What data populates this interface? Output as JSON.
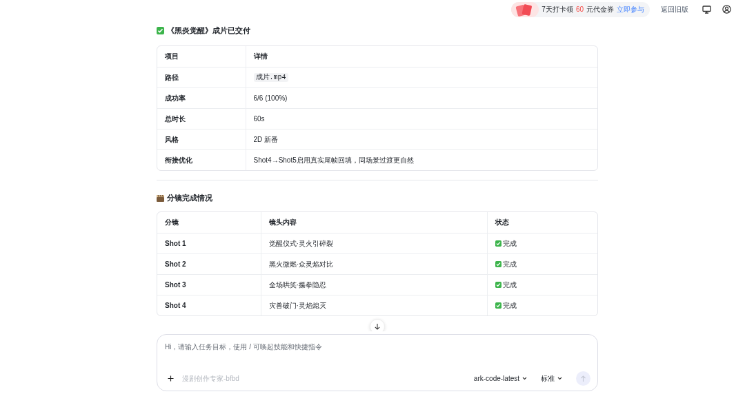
{
  "top_bar": {
    "promo": {
      "prefix": "7天打卡领",
      "amount": "60",
      "suffix": "元代金券",
      "action": "立即参与"
    },
    "old_version": "返回旧版"
  },
  "sections": [
    {
      "heading": "《黑炎觉醒》成片已交付",
      "table": {
        "columns": [
          "项目",
          "详情"
        ],
        "rows": [
          [
            {
              "text": "路径"
            },
            {
              "text": "成片.mp4",
              "kind": "code"
            }
          ],
          [
            {
              "text": "成功率"
            },
            {
              "text": "6/6 (100%)"
            }
          ],
          [
            {
              "text": "总时长"
            },
            {
              "text": "60s"
            }
          ],
          [
            {
              "text": "风格"
            },
            {
              "text": "2D 新番"
            }
          ],
          [
            {
              "text": "衔接优化"
            },
            {
              "text": "Shot4→Shot5启用真实尾帧回填，同场景过渡更自然"
            }
          ]
        ]
      }
    },
    {
      "heading": "分镜完成情况",
      "table": {
        "columns": [
          "分镜",
          "镜头内容",
          "状态"
        ],
        "rows": [
          [
            {
              "text": "Shot 1"
            },
            {
              "text": "觉醒仪式·灵火引碎裂"
            },
            {
              "text": "完成",
              "kind": "done"
            }
          ],
          [
            {
              "text": "Shot 2"
            },
            {
              "text": "黑火微燃·众灵焰对比"
            },
            {
              "text": "完成",
              "kind": "done"
            }
          ],
          [
            {
              "text": "Shot 3"
            },
            {
              "text": "全场哄笑·攥拳隐忍"
            },
            {
              "text": "完成",
              "kind": "done"
            }
          ],
          [
            {
              "text": "Shot 4"
            },
            {
              "text": "灾兽破门·灵焰熄灭"
            },
            {
              "text": "完成",
              "kind": "done"
            }
          ]
        ]
      }
    }
  ],
  "composer": {
    "placeholder": "Hi，请输入任务目标，使用 / 可唤起技能和快捷指令",
    "agent": "漫剧创作专家-bfbd",
    "model": "ark-code-latest",
    "mode": "标准",
    "send_disabled": true
  }
}
